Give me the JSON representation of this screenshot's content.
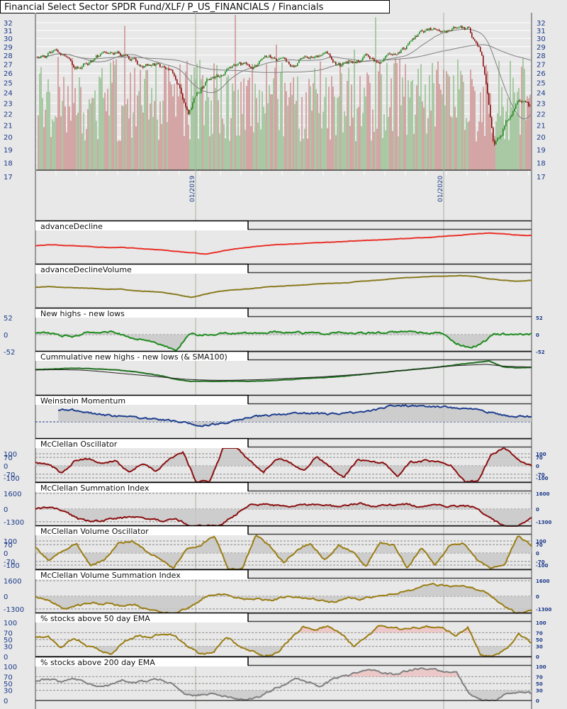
{
  "title": "Financial Select Sector SPDR Fund/XLF/ P_US_FINANCIALS / Financials",
  "colors": {
    "up": "#1e8c1e",
    "down": "#8b1010",
    "vol_up": "#a9c9a4",
    "vol_down": "#d4a5a5",
    "ma": "#808080",
    "accent": "#1a3a8a"
  },
  "chart_data": [
    {
      "type": "candlestick",
      "title": "Financial Select Sector SPDR Fund/XLF/ P_US_FINANCIALS / Financials",
      "y_ticks": [
        "32",
        "31",
        "30",
        "29",
        "28",
        "27",
        "26",
        "25",
        "24",
        "23",
        "22",
        "21",
        "20",
        "19",
        "18",
        "17"
      ],
      "ylim": [
        17,
        32
      ],
      "y_scale": "log",
      "x_labels": [
        "01/2019",
        "01/2020"
      ],
      "price": [
        27.5,
        28,
        27.8,
        26.5,
        27.3,
        28,
        28.3,
        28.2,
        27,
        26.8,
        26.5,
        25,
        22.3,
        24.5,
        25.8,
        26.2,
        26.5,
        26.8,
        27.8,
        27.5,
        26.8,
        27.3,
        28.2,
        28.4,
        27,
        27.5,
        28.2,
        27,
        28,
        29,
        30.3,
        31,
        30.8,
        31,
        31,
        28,
        19.5,
        21.5,
        23,
        22
      ]
    }
  ],
  "panels": [
    {
      "title": "advanceDecline",
      "color": "#e8322a",
      "ylim": [
        0,
        1
      ],
      "fill": false,
      "refs": [],
      "left": [],
      "right": [],
      "values": [
        0.55,
        0.58,
        0.56,
        0.54,
        0.52,
        0.5,
        0.5,
        0.48,
        0.45,
        0.42,
        0.38,
        0.35,
        0.3,
        0.38,
        0.45,
        0.5,
        0.55,
        0.58,
        0.6,
        0.62,
        0.64,
        0.66,
        0.68,
        0.7,
        0.72,
        0.74,
        0.76,
        0.78,
        0.8,
        0.83,
        0.86,
        0.9,
        0.92,
        0.9,
        0.86,
        0.85
      ]
    },
    {
      "title": "advanceDeclineVolume",
      "color": "#8a7a20",
      "ylim": [
        0,
        1
      ],
      "fill": false,
      "refs": [],
      "left": [],
      "right": [],
      "values": [
        0.6,
        0.62,
        0.6,
        0.58,
        0.57,
        0.55,
        0.55,
        0.5,
        0.48,
        0.45,
        0.38,
        0.3,
        0.4,
        0.48,
        0.52,
        0.55,
        0.6,
        0.63,
        0.65,
        0.67,
        0.7,
        0.72,
        0.73,
        0.78,
        0.8,
        0.84,
        0.88,
        0.9,
        0.92,
        0.93,
        0.94,
        0.92,
        0.85,
        0.8,
        0.78,
        0.8
      ]
    },
    {
      "title": "New highs - new lows",
      "color": "#1e8c1e",
      "ylim": [
        -52,
        52
      ],
      "fill": true,
      "base": 0,
      "refs": [
        0
      ],
      "left": [
        "52",
        "0",
        "-52"
      ],
      "right": [
        "52",
        "0",
        "-52"
      ],
      "tickvals": [
        52,
        0,
        -52
      ],
      "values": [
        5,
        3,
        -2,
        -5,
        6,
        3,
        8,
        -3,
        -12,
        -20,
        -30,
        -52,
        0,
        0,
        2,
        3,
        4,
        5,
        6,
        8,
        5,
        6,
        3,
        4,
        8,
        3,
        5,
        6,
        8,
        10,
        8,
        5,
        3,
        -25,
        -40,
        -30,
        0,
        2,
        0,
        1
      ]
    },
    {
      "title": "Cummulative new highs - new lows (& SMA100)",
      "color": "#1e6e1e",
      "color2": "#222222",
      "ylim": [
        0,
        1
      ],
      "fill": false,
      "refs": [],
      "left": [],
      "right": [],
      "values": [
        0.75,
        0.76,
        0.78,
        0.78,
        0.77,
        0.75,
        0.72,
        0.68,
        0.62,
        0.55,
        0.45,
        0.4,
        0.4,
        0.4,
        0.4,
        0.4,
        0.41,
        0.43,
        0.45,
        0.48,
        0.5,
        0.53,
        0.56,
        0.6,
        0.64,
        0.68,
        0.72,
        0.76,
        0.8,
        0.85,
        0.9,
        0.95,
        1.0,
        0.82,
        0.8,
        0.8
      ],
      "values2": [
        0.73,
        0.74,
        0.74,
        0.73,
        0.7,
        0.66,
        0.62,
        0.58,
        0.54,
        0.5,
        0.46,
        0.44,
        0.43,
        0.43,
        0.44,
        0.45,
        0.47,
        0.49,
        0.51,
        0.53,
        0.56,
        0.59,
        0.62,
        0.66,
        0.7,
        0.74,
        0.78,
        0.82,
        0.86,
        0.88,
        0.9,
        0.85,
        0.83,
        0.82
      ]
    },
    {
      "title": "Weinstein Momentum",
      "color": "#1f3f8f",
      "ylim": [
        -1,
        1
      ],
      "fill": true,
      "base": 0,
      "refs": [
        0
      ],
      "refstyle": "blue",
      "left": [],
      "right": [],
      "start": 0.045,
      "values": [
        0.7,
        0.7,
        0.6,
        0.45,
        0.35,
        0.3,
        0.25,
        0.15,
        0.1,
        0.0,
        -0.15,
        -0.2,
        -0.1,
        0.05,
        0.2,
        0.35,
        0.4,
        0.45,
        0.5,
        0.5,
        0.45,
        0.5,
        0.55,
        0.65,
        0.8,
        1.0,
        0.95,
        0.9,
        0.9,
        0.85,
        0.8,
        0.7,
        0.55,
        0.4,
        0.3,
        0.3
      ]
    },
    {
      "title": "McClellan Oscillator",
      "color": "#8b1010",
      "ylim": [
        -135,
        147
      ],
      "fill": true,
      "base": 0,
      "refs": [
        100,
        70,
        0,
        -70,
        -100
      ],
      "left": [
        "100",
        "70",
        "0",
        "-70",
        "-100"
      ],
      "right": [
        "100",
        "70",
        "0",
        "-70",
        "-100"
      ],
      "tickvals": [
        100,
        70,
        0,
        -70,
        -100
      ],
      "values": [
        30,
        10,
        -60,
        50,
        60,
        20,
        40,
        -60,
        20,
        -40,
        60,
        110,
        -130,
        -130,
        147,
        147,
        40,
        -50,
        60,
        30,
        -40,
        80,
        -10,
        -100,
        50,
        40,
        20,
        -80,
        30,
        40,
        30,
        10,
        -130,
        -130,
        100,
        147,
        50,
        0
      ]
    },
    {
      "title": "McClellan Summation Index",
      "color": "#8b1010",
      "ylim": [
        -1745,
        1745
      ],
      "fill": true,
      "base": 0,
      "refs": [
        1600,
        0,
        -1300
      ],
      "left": [
        "1600",
        "0",
        "-1300"
      ],
      "right": [
        "1600",
        "0",
        "-1300"
      ],
      "tickvals": [
        1600,
        0,
        -1300
      ],
      "values": [
        0,
        200,
        -200,
        -1000,
        -1300,
        -1100,
        -900,
        -800,
        -1000,
        -1200,
        -1100,
        -1745,
        -1745,
        -1745,
        -700,
        400,
        500,
        350,
        200,
        400,
        500,
        300,
        350,
        600,
        200,
        400,
        500,
        300,
        400,
        350,
        250,
        200,
        -800,
        -1745,
        -1745,
        -1000
      ]
    },
    {
      "title": "McClellan Volume Oscillator",
      "color": "#9a7d14",
      "ylim": [
        -135,
        147
      ],
      "fill": true,
      "base": 0,
      "refs": [
        100,
        70,
        0,
        -70,
        -100
      ],
      "left": [
        "100",
        "70",
        "0",
        "-70",
        "-100"
      ],
      "right": [
        "100",
        "70",
        "0",
        "-70",
        "-100"
      ],
      "tickvals": [
        100,
        70,
        0,
        -70,
        -100
      ],
      "values": [
        40,
        -60,
        30,
        70,
        -100,
        -60,
        80,
        100,
        20,
        -40,
        -120,
        30,
        60,
        147,
        -135,
        -135,
        147,
        60,
        -80,
        30,
        80,
        -60,
        70,
        10,
        -110,
        90,
        60,
        -120,
        40,
        -100,
        60,
        80,
        -50,
        -120,
        -110,
        147,
        60
      ]
    },
    {
      "title": "McClellan Volume Summation Index",
      "color": "#9a7d14",
      "ylim": [
        -1745,
        1745
      ],
      "fill": true,
      "base": 0,
      "refs": [
        1600,
        0,
        -1300
      ],
      "left": [
        "1600",
        "0",
        "-1300"
      ],
      "right": [
        "1600",
        "0",
        "-1300"
      ],
      "tickvals": [
        1600,
        0,
        -1300
      ],
      "values": [
        0,
        -500,
        -1300,
        -900,
        -700,
        -800,
        -1000,
        -900,
        -1300,
        -1700,
        -1745,
        -1000,
        0,
        300,
        -200,
        -300,
        -400,
        -300,
        0,
        -200,
        -300,
        -600,
        -100,
        -300,
        0,
        200,
        400,
        900,
        1200,
        1100,
        1000,
        800,
        200,
        -1000,
        -1745,
        -1400
      ]
    },
    {
      "title": "% stocks above 50 day EMA",
      "color": "#9a7d14",
      "ylim": [
        0,
        100
      ],
      "fill": "band",
      "refs": [
        70,
        50,
        30
      ],
      "left": [
        "100",
        "70",
        "50",
        "30",
        "0"
      ],
      "right": [
        "100",
        "70",
        "50",
        "30",
        "0"
      ],
      "tickvals": [
        100,
        70,
        50,
        30,
        0
      ],
      "values": [
        55,
        60,
        25,
        55,
        30,
        20,
        5,
        45,
        60,
        55,
        70,
        60,
        30,
        5,
        10,
        60,
        30,
        15,
        0,
        10,
        50,
        88,
        80,
        90,
        70,
        30,
        60,
        88,
        85,
        80,
        85,
        88,
        85,
        60,
        85,
        5,
        0,
        20,
        65,
        40
      ]
    },
    {
      "title": "% stocks above 200 day EMA",
      "color": "#808080",
      "ylim": [
        0,
        100
      ],
      "fill": "band",
      "refs": [
        70,
        50,
        30
      ],
      "left": [
        "100",
        "70",
        "50",
        "30",
        "0"
      ],
      "right": [
        "100",
        "70",
        "50",
        "30",
        "0"
      ],
      "tickvals": [
        100,
        70,
        50,
        30,
        0
      ],
      "values": [
        60,
        62,
        55,
        65,
        55,
        40,
        45,
        60,
        55,
        58,
        62,
        50,
        18,
        15,
        20,
        15,
        5,
        0,
        10,
        30,
        45,
        65,
        55,
        40,
        65,
        70,
        85,
        90,
        80,
        75,
        88,
        95,
        92,
        85,
        80,
        20,
        0,
        0,
        20,
        25,
        20
      ]
    }
  ]
}
